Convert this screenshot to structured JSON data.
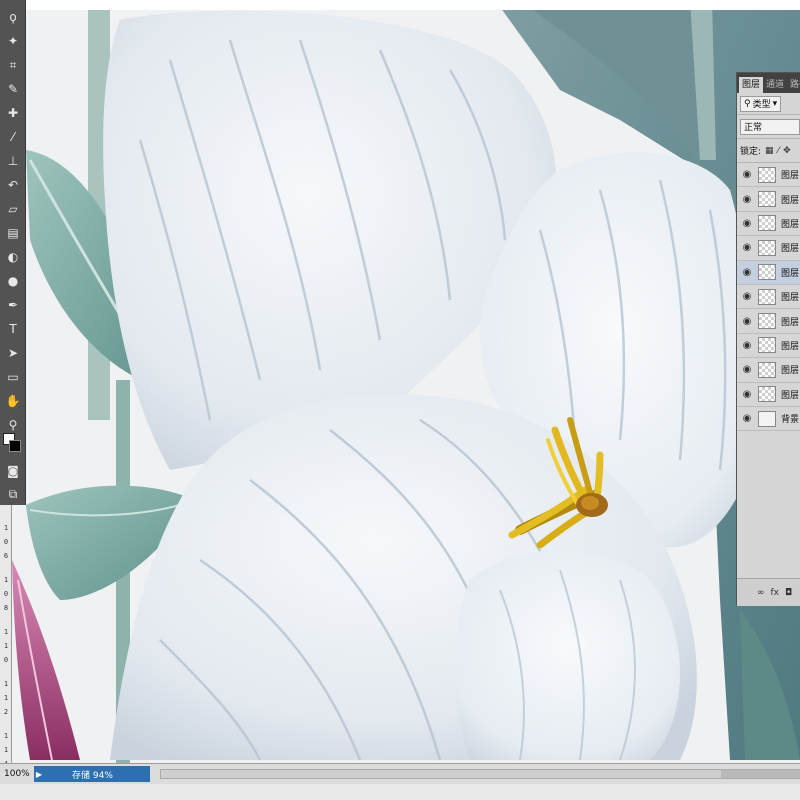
{
  "app": {
    "zoom": "100%",
    "status_text": "存储 94%",
    "progress": 0.94
  },
  "colors": {
    "accent_status": "#2e6fb0",
    "toolbar_bg": "#535353",
    "panel_bg": "#d6d6d6",
    "petal_white": "#eef2f6",
    "stamen_yellow": "#e0b820",
    "leaf_teal": "#7fa6a2"
  },
  "toolbar": {
    "tools": [
      {
        "icon": "lasso-icon",
        "glyph": "ϙ"
      },
      {
        "icon": "magic-wand-icon",
        "glyph": "✦"
      },
      {
        "icon": "crop-icon",
        "glyph": "⌗"
      },
      {
        "icon": "eyedropper-icon",
        "glyph": "✎"
      },
      {
        "icon": "healing-brush-icon",
        "glyph": "✚"
      },
      {
        "icon": "brush-icon",
        "glyph": "⁄"
      },
      {
        "icon": "clone-stamp-icon",
        "glyph": "⊥"
      },
      {
        "icon": "history-brush-icon",
        "glyph": "↶"
      },
      {
        "icon": "eraser-icon",
        "glyph": "▱"
      },
      {
        "icon": "gradient-icon",
        "glyph": "▤"
      },
      {
        "icon": "blur-icon",
        "glyph": "◐"
      },
      {
        "icon": "dodge-icon",
        "glyph": "●"
      },
      {
        "icon": "pen-icon",
        "glyph": "✒"
      },
      {
        "icon": "type-icon",
        "glyph": "T"
      },
      {
        "icon": "path-selection-icon",
        "glyph": "➤"
      },
      {
        "icon": "rectangle-icon",
        "glyph": "▭"
      },
      {
        "icon": "hand-icon",
        "glyph": "✋"
      },
      {
        "icon": "zoom-icon",
        "glyph": "⚲"
      }
    ],
    "mask_icon": "◙",
    "screen_mode_icon": "⧉"
  },
  "ruler": {
    "labels": [
      "1",
      "0",
      "6",
      "1",
      "0",
      "8",
      "1",
      "1",
      "0",
      "1",
      "1",
      "2",
      "1",
      "1",
      "4"
    ]
  },
  "layers_panel": {
    "tabs": [
      "图层",
      "通道",
      "路径"
    ],
    "filter_label": "类型",
    "blend_mode": "正常",
    "lock_label": "锁定:",
    "lock_icons": [
      "lock-pixels-icon",
      "lock-brush-icon",
      "lock-move-icon"
    ],
    "layers": [
      {
        "name": "图层",
        "selected": false,
        "thumb": "transparent"
      },
      {
        "name": "图层",
        "selected": false,
        "thumb": "transparent"
      },
      {
        "name": "图层",
        "selected": false,
        "thumb": "transparent"
      },
      {
        "name": "图层",
        "selected": false,
        "thumb": "transparent"
      },
      {
        "name": "图层",
        "selected": true,
        "thumb": "transparent"
      },
      {
        "name": "图层",
        "selected": false,
        "thumb": "transparent"
      },
      {
        "name": "图层",
        "selected": false,
        "thumb": "transparent"
      },
      {
        "name": "图层",
        "selected": false,
        "thumb": "transparent"
      },
      {
        "name": "图层",
        "selected": false,
        "thumb": "transparent"
      },
      {
        "name": "图层",
        "selected": false,
        "thumb": "transparent"
      },
      {
        "name": "背景",
        "selected": false,
        "thumb": "solid"
      }
    ],
    "footer_icons": [
      "link-icon",
      "fx-icon",
      "mask-icon"
    ],
    "footer_labels": [
      "∞",
      "fx",
      "◘"
    ]
  }
}
